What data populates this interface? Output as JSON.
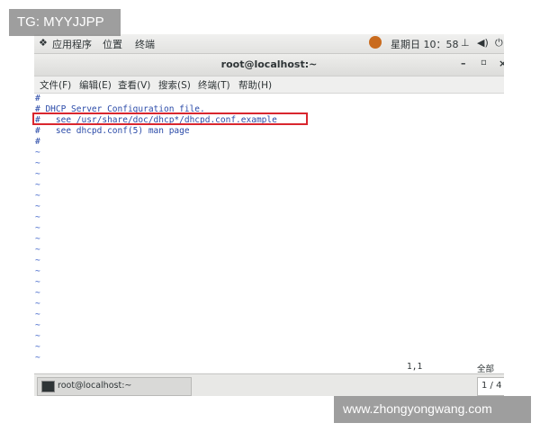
{
  "watermarks": {
    "top_left": "TG: MYYJJPP",
    "bottom_right": "www.zhongyongwang.com"
  },
  "topbar": {
    "applications": "应用程序",
    "places": "位置",
    "terminal": "终端",
    "clock": "星期日 10：58",
    "network_icon": "network-icon",
    "volume_icon": "volume-icon",
    "power_icon": "power-icon"
  },
  "window": {
    "title": "root@localhost:~",
    "minimize": "–",
    "maximize": "▫",
    "close": "×"
  },
  "menu": [
    "文件(F)",
    "编辑(E)",
    "查看(V)",
    "搜索(S)",
    "终端(T)",
    "帮助(H)"
  ],
  "editor": {
    "lines": [
      "#",
      "# DHCP Server Configuration file.",
      "#   see /usr/share/doc/dhcp*/dhcpd.conf.example",
      "#   see dhcpd.conf(5) man page",
      "#"
    ],
    "tilde": "~",
    "cursor_position": "1,1",
    "scroll_position": "全部"
  },
  "taskbar": {
    "task_label": "root@localhost:~",
    "pager": "1 / 4"
  },
  "colors": {
    "highlight_box": "#d9262e",
    "text": "#2a4aa8"
  }
}
